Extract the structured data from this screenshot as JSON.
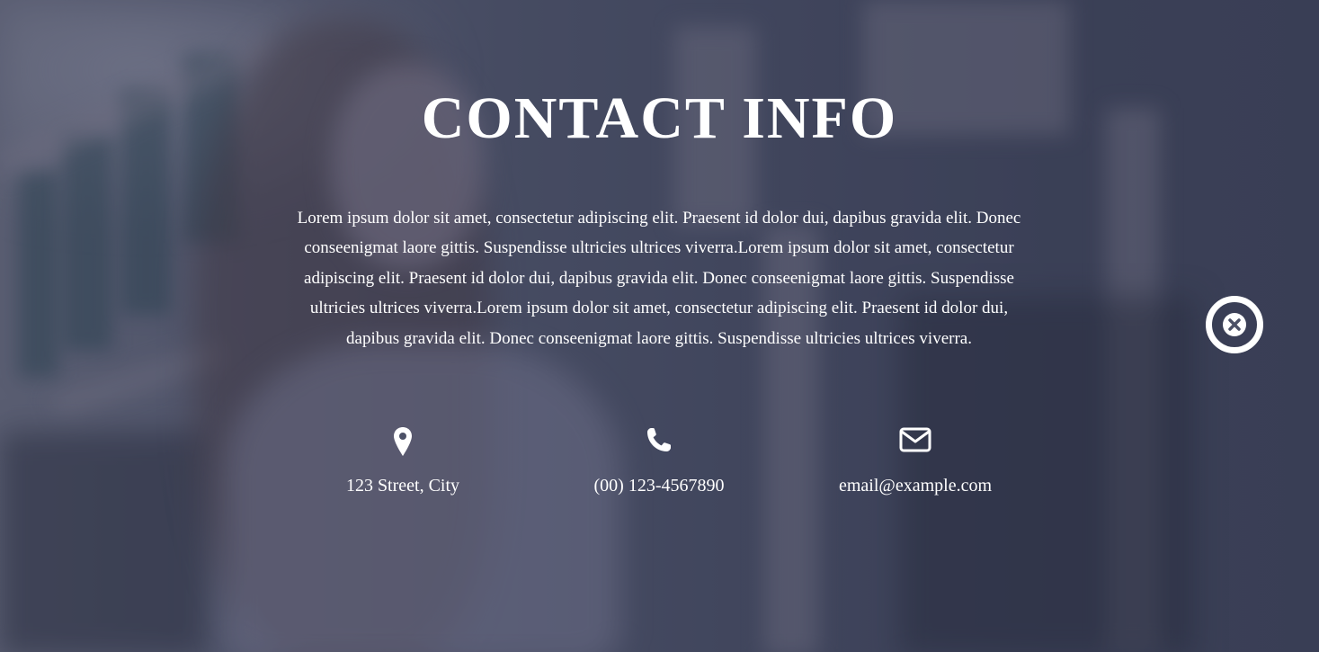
{
  "header": {
    "title": "CONTACT INFO"
  },
  "main": {
    "description": "Lorem ipsum dolor sit amet, consectetur adipiscing elit. Praesent id dolor dui, dapibus gravida elit. Donec conseenigmat laore gittis. Suspendisse ultricies ultrices viverra.Lorem ipsum dolor sit amet, consectetur adipiscing elit. Praesent id dolor dui, dapibus gravida elit. Donec conseenigmat laore gittis. Suspendisse ultricies ultrices viverra.Lorem ipsum dolor sit amet, consectetur adipiscing elit. Praesent id dolor dui, dapibus gravida elit. Donec conseenigmat laore gittis. Suspendisse ultricies ultrices viverra."
  },
  "contacts": [
    {
      "icon": "map-marker-icon",
      "label": "123 Street, City"
    },
    {
      "icon": "phone-icon",
      "label": "(00) 123-4567890"
    },
    {
      "icon": "envelope-icon",
      "label": "email@example.com"
    }
  ],
  "controls": {
    "close_icon": "close-circle-icon"
  },
  "colors": {
    "text": "#ffffff",
    "overlay": "#373c55"
  }
}
